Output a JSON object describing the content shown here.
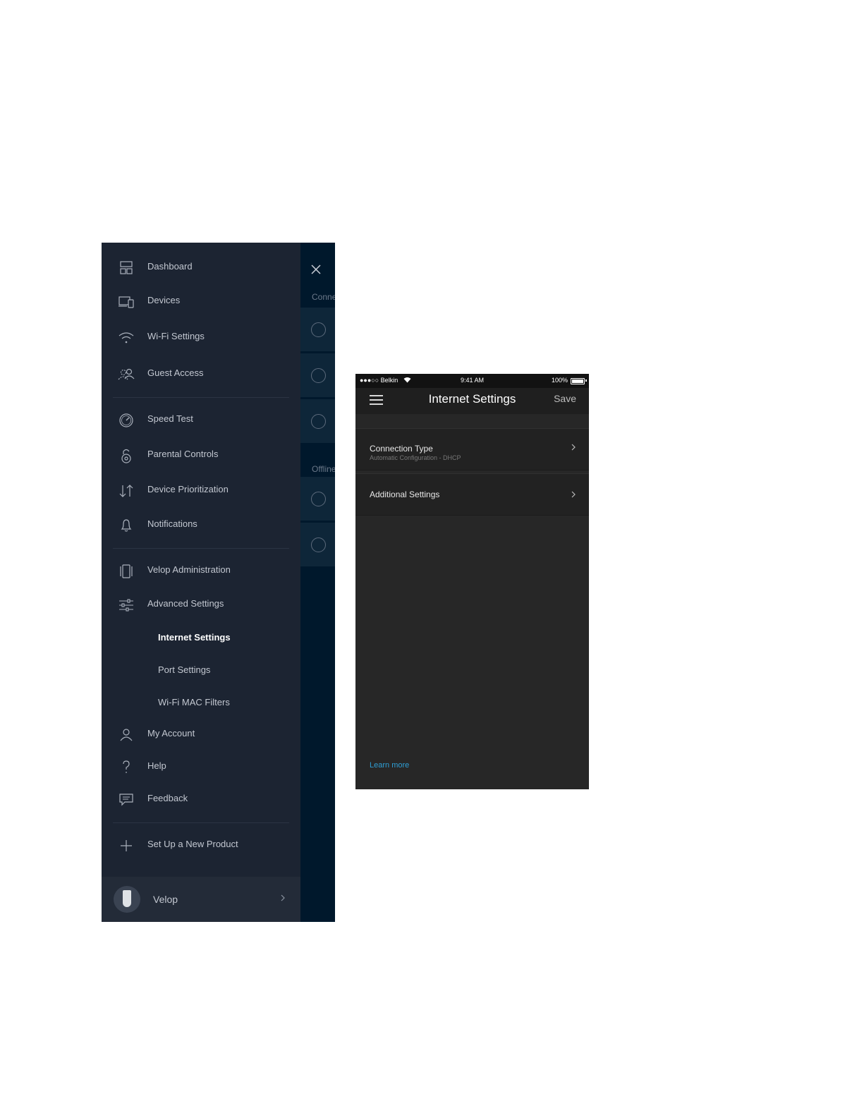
{
  "drawer": {
    "items": [
      {
        "label": "Dashboard",
        "icon": "dashboard-icon"
      },
      {
        "label": "Devices",
        "icon": "devices-icon"
      },
      {
        "label": "Wi-Fi Settings",
        "icon": "wifi-icon"
      },
      {
        "label": "Guest Access",
        "icon": "guest-access-icon"
      },
      {
        "label": "Speed Test",
        "icon": "speedometer-icon"
      },
      {
        "label": "Parental Controls",
        "icon": "lock-icon"
      },
      {
        "label": "Device Prioritization",
        "icon": "up-down-arrows-icon"
      },
      {
        "label": "Notifications",
        "icon": "bell-icon"
      },
      {
        "label": "Velop Administration",
        "icon": "velop-node-icon"
      },
      {
        "label": "Advanced Settings",
        "icon": "sliders-icon"
      }
    ],
    "advanced_sub_items": [
      {
        "label": "Internet Settings",
        "active": true
      },
      {
        "label": "Port Settings",
        "active": false
      },
      {
        "label": "Wi-Fi MAC Filters",
        "active": false
      }
    ],
    "bottom_items": [
      {
        "label": "My Account",
        "icon": "user-icon"
      },
      {
        "label": "Help",
        "icon": "question-icon"
      },
      {
        "label": "Feedback",
        "icon": "speech-bubble-icon"
      }
    ],
    "setup_label": "Set Up a New Product",
    "product_name": "Velop"
  },
  "background": {
    "section_connected": "Conne",
    "section_offline": "Offline"
  },
  "phone": {
    "status": {
      "carrier": "●●●○○ Belkin",
      "time": "9:41 AM",
      "battery": "100%"
    },
    "title": "Internet Settings",
    "save_label": "Save",
    "rows": [
      {
        "title": "Connection Type",
        "subtitle": "Automatic Configuration - DHCP"
      },
      {
        "title": "Additional Settings"
      }
    ],
    "learn_more": "Learn more"
  },
  "colors": {
    "drawer_bg": "#1c2432",
    "dashboard_bg": "#00182c",
    "phone_bg": "#272727",
    "link": "#2f9ed4"
  }
}
